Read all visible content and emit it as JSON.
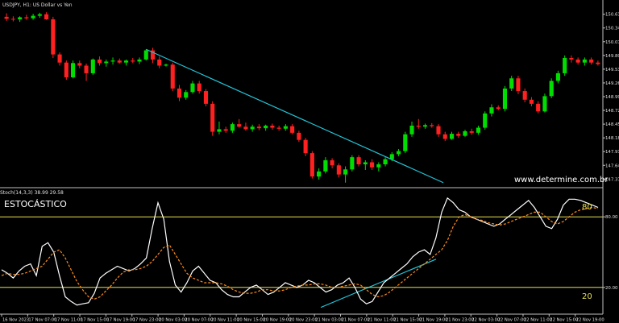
{
  "main": {
    "symbol_header": "USDJPY, H1:  US Dollar vs Yen",
    "watermark": "www.determine.com.br",
    "price_ticks": [
      "150.610",
      "150.340",
      "150.070",
      "149.800",
      "149.530",
      "149.260",
      "148.990",
      "148.720",
      "148.450",
      "148.180",
      "147.910",
      "147.640",
      "147.370"
    ],
    "colors": {
      "bull": "#00dd00",
      "bear": "#ff2020",
      "trendline": "#22c4d8",
      "grid": "#1a1a1a"
    }
  },
  "oscillator": {
    "header": "Stoch(14,3,3) 38.99 29.58",
    "label": "ESTOCÁSTICO",
    "level_high_label": "80",
    "level_low_label": "20",
    "colors": {
      "main": "#ffffff",
      "signal": "#ff8c1a",
      "levels": "#e8e050"
    }
  },
  "time_axis": {
    "labels": [
      "16 Nov 2023",
      "17 Nov 07:00",
      "17 Nov 11:00",
      "17 Nov 15:00",
      "17 Nov 19:00",
      "17 Nov 23:00",
      "20 Nov 03:00",
      "20 Nov 07:00",
      "20 Nov 11:00",
      "20 Nov 15:00",
      "20 Nov 19:00",
      "20 Nov 23:00",
      "21 Nov 03:00",
      "21 Nov 07:00",
      "21 Nov 11:00",
      "21 Nov 15:00",
      "21 Nov 19:00",
      "21 Nov 23:00",
      "22 Nov 03:00",
      "22 Nov 07:00",
      "22 Nov 11:00",
      "22 Nov 15:00",
      "22 Nov 19:00"
    ]
  },
  "chart_data": [
    {
      "type": "candlestick",
      "title": "USDJPY, H1:  US Dollar vs Yen",
      "ylim": [
        147.28,
        150.7
      ],
      "candles": [
        {
          "o": 150.56,
          "h": 150.63,
          "l": 150.48,
          "c": 150.52
        },
        {
          "o": 150.52,
          "h": 150.57,
          "l": 150.47,
          "c": 150.51
        },
        {
          "o": 150.51,
          "h": 150.57,
          "l": 150.46,
          "c": 150.55
        },
        {
          "o": 150.55,
          "h": 150.6,
          "l": 150.5,
          "c": 150.53
        },
        {
          "o": 150.53,
          "h": 150.62,
          "l": 150.5,
          "c": 150.58
        },
        {
          "o": 150.58,
          "h": 150.64,
          "l": 150.54,
          "c": 150.61
        },
        {
          "o": 150.61,
          "h": 150.65,
          "l": 150.5,
          "c": 150.51
        },
        {
          "o": 150.51,
          "h": 150.56,
          "l": 149.75,
          "c": 149.82
        },
        {
          "o": 149.82,
          "h": 149.86,
          "l": 149.6,
          "c": 149.66
        },
        {
          "o": 149.66,
          "h": 149.7,
          "l": 149.32,
          "c": 149.37
        },
        {
          "o": 149.37,
          "h": 149.7,
          "l": 149.35,
          "c": 149.65
        },
        {
          "o": 149.65,
          "h": 149.7,
          "l": 149.55,
          "c": 149.6
        },
        {
          "o": 149.6,
          "h": 149.64,
          "l": 149.3,
          "c": 149.45
        },
        {
          "o": 149.45,
          "h": 149.74,
          "l": 149.42,
          "c": 149.72
        },
        {
          "o": 149.72,
          "h": 149.78,
          "l": 149.6,
          "c": 149.65
        },
        {
          "o": 149.65,
          "h": 149.72,
          "l": 149.58,
          "c": 149.68
        },
        {
          "o": 149.68,
          "h": 149.76,
          "l": 149.62,
          "c": 149.7
        },
        {
          "o": 149.7,
          "h": 149.74,
          "l": 149.64,
          "c": 149.66
        },
        {
          "o": 149.66,
          "h": 149.72,
          "l": 149.6,
          "c": 149.7
        },
        {
          "o": 149.7,
          "h": 149.75,
          "l": 149.65,
          "c": 149.68
        },
        {
          "o": 149.68,
          "h": 149.76,
          "l": 149.63,
          "c": 149.72
        },
        {
          "o": 149.72,
          "h": 149.92,
          "l": 149.7,
          "c": 149.9
        },
        {
          "o": 149.9,
          "h": 149.95,
          "l": 149.65,
          "c": 149.72
        },
        {
          "o": 149.72,
          "h": 149.78,
          "l": 149.55,
          "c": 149.6
        },
        {
          "o": 149.6,
          "h": 149.64,
          "l": 149.58,
          "c": 149.62
        },
        {
          "o": 149.62,
          "h": 149.66,
          "l": 149.1,
          "c": 149.15
        },
        {
          "o": 149.15,
          "h": 149.22,
          "l": 148.9,
          "c": 148.97
        },
        {
          "o": 148.97,
          "h": 149.12,
          "l": 148.93,
          "c": 149.08
        },
        {
          "o": 149.08,
          "h": 149.3,
          "l": 149.05,
          "c": 149.25
        },
        {
          "o": 149.25,
          "h": 149.3,
          "l": 149.05,
          "c": 149.1
        },
        {
          "o": 149.1,
          "h": 149.14,
          "l": 148.8,
          "c": 148.85
        },
        {
          "o": 148.85,
          "h": 148.9,
          "l": 148.22,
          "c": 148.3
        },
        {
          "o": 148.3,
          "h": 148.5,
          "l": 148.25,
          "c": 148.35
        },
        {
          "o": 148.35,
          "h": 148.4,
          "l": 148.28,
          "c": 148.32
        },
        {
          "o": 148.32,
          "h": 148.48,
          "l": 148.28,
          "c": 148.45
        },
        {
          "o": 148.45,
          "h": 148.55,
          "l": 148.38,
          "c": 148.4
        },
        {
          "o": 148.4,
          "h": 148.48,
          "l": 148.32,
          "c": 148.35
        },
        {
          "o": 148.35,
          "h": 148.44,
          "l": 148.3,
          "c": 148.4
        },
        {
          "o": 148.4,
          "h": 148.45,
          "l": 148.33,
          "c": 148.37
        },
        {
          "o": 148.37,
          "h": 148.44,
          "l": 148.32,
          "c": 148.42
        },
        {
          "o": 148.42,
          "h": 148.46,
          "l": 148.34,
          "c": 148.38
        },
        {
          "o": 148.38,
          "h": 148.42,
          "l": 148.32,
          "c": 148.36
        },
        {
          "o": 148.36,
          "h": 148.45,
          "l": 148.32,
          "c": 148.41
        },
        {
          "o": 148.41,
          "h": 148.45,
          "l": 148.25,
          "c": 148.28
        },
        {
          "o": 148.28,
          "h": 148.32,
          "l": 148.1,
          "c": 148.14
        },
        {
          "o": 148.14,
          "h": 148.18,
          "l": 147.82,
          "c": 147.88
        },
        {
          "o": 147.88,
          "h": 147.92,
          "l": 147.38,
          "c": 147.42
        },
        {
          "o": 147.42,
          "h": 147.58,
          "l": 147.36,
          "c": 147.52
        },
        {
          "o": 147.52,
          "h": 147.8,
          "l": 147.48,
          "c": 147.74
        },
        {
          "o": 147.74,
          "h": 147.78,
          "l": 147.58,
          "c": 147.64
        },
        {
          "o": 147.64,
          "h": 147.68,
          "l": 147.4,
          "c": 147.46
        },
        {
          "o": 147.46,
          "h": 147.62,
          "l": 147.3,
          "c": 147.56
        },
        {
          "o": 147.56,
          "h": 147.84,
          "l": 147.52,
          "c": 147.8
        },
        {
          "o": 147.8,
          "h": 147.84,
          "l": 147.62,
          "c": 147.66
        },
        {
          "o": 147.66,
          "h": 147.74,
          "l": 147.55,
          "c": 147.7
        },
        {
          "o": 147.7,
          "h": 147.76,
          "l": 147.55,
          "c": 147.6
        },
        {
          "o": 147.6,
          "h": 147.7,
          "l": 147.52,
          "c": 147.66
        },
        {
          "o": 147.66,
          "h": 147.8,
          "l": 147.62,
          "c": 147.76
        },
        {
          "o": 147.76,
          "h": 147.9,
          "l": 147.72,
          "c": 147.86
        },
        {
          "o": 147.86,
          "h": 147.96,
          "l": 147.82,
          "c": 147.92
        },
        {
          "o": 147.92,
          "h": 148.3,
          "l": 147.88,
          "c": 148.25
        },
        {
          "o": 148.25,
          "h": 148.5,
          "l": 148.2,
          "c": 148.42
        },
        {
          "o": 148.42,
          "h": 148.55,
          "l": 148.36,
          "c": 148.4
        },
        {
          "o": 148.4,
          "h": 148.46,
          "l": 148.36,
          "c": 148.43
        },
        {
          "o": 148.43,
          "h": 148.47,
          "l": 148.38,
          "c": 148.41
        },
        {
          "o": 148.41,
          "h": 148.45,
          "l": 148.2,
          "c": 148.25
        },
        {
          "o": 148.25,
          "h": 148.3,
          "l": 148.12,
          "c": 148.16
        },
        {
          "o": 148.16,
          "h": 148.3,
          "l": 148.14,
          "c": 148.26
        },
        {
          "o": 148.26,
          "h": 148.3,
          "l": 148.18,
          "c": 148.22
        },
        {
          "o": 148.22,
          "h": 148.34,
          "l": 148.2,
          "c": 148.31
        },
        {
          "o": 148.31,
          "h": 148.36,
          "l": 148.24,
          "c": 148.28
        },
        {
          "o": 148.28,
          "h": 148.42,
          "l": 148.24,
          "c": 148.38
        },
        {
          "o": 148.38,
          "h": 148.7,
          "l": 148.34,
          "c": 148.66
        },
        {
          "o": 148.66,
          "h": 148.84,
          "l": 148.6,
          "c": 148.78
        },
        {
          "o": 148.78,
          "h": 148.82,
          "l": 148.72,
          "c": 148.75
        },
        {
          "o": 148.75,
          "h": 149.2,
          "l": 148.7,
          "c": 149.15
        },
        {
          "o": 149.15,
          "h": 149.4,
          "l": 149.1,
          "c": 149.35
        },
        {
          "o": 149.35,
          "h": 149.4,
          "l": 149.04,
          "c": 149.1
        },
        {
          "o": 149.1,
          "h": 149.15,
          "l": 148.88,
          "c": 148.93
        },
        {
          "o": 148.93,
          "h": 148.98,
          "l": 148.8,
          "c": 148.85
        },
        {
          "o": 148.85,
          "h": 148.9,
          "l": 148.66,
          "c": 148.7
        },
        {
          "o": 148.7,
          "h": 149.05,
          "l": 148.68,
          "c": 149.0
        },
        {
          "o": 149.0,
          "h": 149.35,
          "l": 148.96,
          "c": 149.3
        },
        {
          "o": 149.3,
          "h": 149.5,
          "l": 149.25,
          "c": 149.45
        },
        {
          "o": 149.45,
          "h": 149.8,
          "l": 149.4,
          "c": 149.75
        },
        {
          "o": 149.75,
          "h": 149.8,
          "l": 149.66,
          "c": 149.72
        },
        {
          "o": 149.72,
          "h": 149.76,
          "l": 149.62,
          "c": 149.66
        },
        {
          "o": 149.66,
          "h": 149.76,
          "l": 149.6,
          "c": 149.72
        },
        {
          "o": 149.72,
          "h": 149.76,
          "l": 149.62,
          "c": 149.66
        },
        {
          "o": 149.66,
          "h": 149.7,
          "l": 149.6,
          "c": 149.63
        }
      ]
    },
    {
      "type": "line",
      "title": "Stoch(14,3,3) 38.99 29.58",
      "ylim": [
        0,
        100
      ],
      "levels": [
        80,
        20
      ],
      "series": [
        {
          "values": [
            35,
            32,
            28,
            34,
            38,
            40,
            30,
            55,
            58,
            50,
            30,
            12,
            8,
            5,
            6,
            7,
            15,
            28,
            32,
            35,
            38,
            36,
            34,
            36,
            40,
            45,
            70,
            92,
            78,
            42,
            22,
            16,
            24,
            34,
            38,
            32,
            26,
            24,
            18,
            14,
            12,
            12,
            16,
            20,
            22,
            18,
            14,
            16,
            20,
            24,
            22,
            20,
            22,
            26,
            24,
            20,
            16,
            18,
            22,
            24,
            28,
            20,
            10,
            6,
            8,
            16,
            24,
            28,
            32,
            36,
            40,
            46,
            50,
            52,
            48,
            62,
            84,
            96,
            92,
            86,
            84,
            80,
            78,
            76,
            74,
            72,
            74,
            78,
            82,
            86,
            90,
            94,
            88,
            80,
            72,
            70,
            78,
            90,
            95,
            95,
            94,
            92,
            90,
            88
          ]
        },
        {
          "values": [
            30,
            32,
            31,
            31,
            32,
            34,
            36,
            38,
            44,
            50,
            52,
            45,
            35,
            25,
            18,
            12,
            10,
            12,
            17,
            22,
            28,
            33,
            35,
            35,
            36,
            38,
            42,
            48,
            54,
            56,
            48,
            40,
            32,
            28,
            26,
            24,
            24,
            24,
            23,
            21,
            18,
            16,
            15,
            15,
            16,
            18,
            18,
            17,
            17,
            18,
            20,
            21,
            22,
            22,
            23,
            23,
            22,
            20,
            20,
            21,
            22,
            23,
            22,
            18,
            14,
            12,
            13,
            16,
            20,
            24,
            28,
            32,
            36,
            40,
            44,
            48,
            52,
            60,
            72,
            80,
            82,
            80,
            78,
            77,
            75,
            74,
            73,
            74,
            76,
            78,
            80,
            82,
            84,
            84,
            80,
            76,
            74,
            76,
            80,
            84,
            86,
            87,
            88,
            87
          ]
        }
      ]
    }
  ]
}
